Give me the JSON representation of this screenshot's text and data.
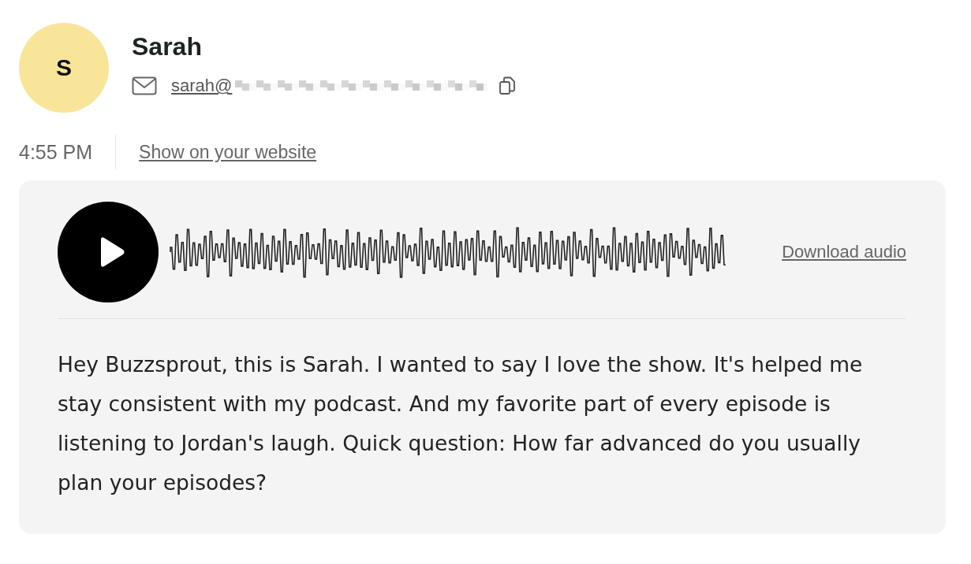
{
  "contact": {
    "initial": "S",
    "name": "Sarah",
    "email_visible": "sarah@"
  },
  "message": {
    "time": "4:55 PM",
    "website_link": "Show on your website"
  },
  "audio": {
    "playing": false,
    "download_label": "Download audio"
  },
  "transcript": "Hey Buzzsprout, this is Sarah. I wanted to say I love the show. It's helped me stay consistent with my podcast. And my favorite part of every episode is listening to Jordan's laugh. Quick question: How far advanced do you usually plan your episodes?"
}
